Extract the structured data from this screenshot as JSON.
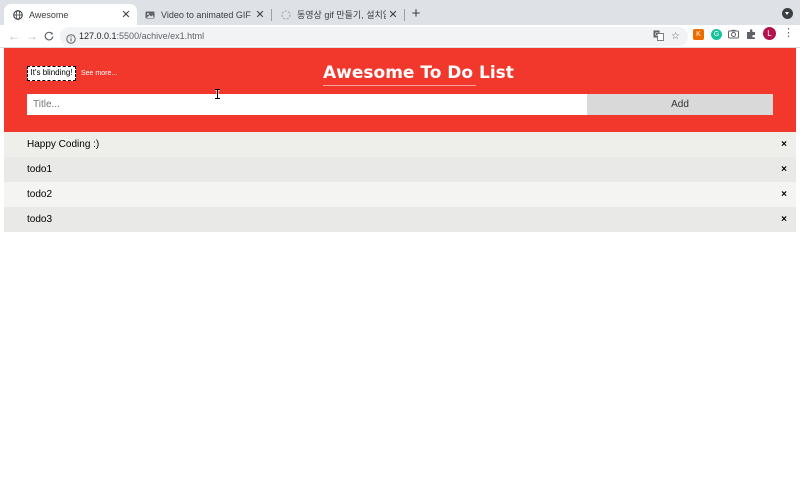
{
  "browser": {
    "tabs": [
      {
        "title": "Awesome",
        "icon": "globe-icon",
        "active": true
      },
      {
        "title": "Video to animated GIF converte",
        "icon": "image-icon",
        "active": false
      },
      {
        "title": "동영상 gif 만들기, 설치없이 동빨 만",
        "icon": "loading-icon",
        "active": false
      }
    ],
    "url_host": "127.0.0.1",
    "url_rest": ":5500/achive/ex1.html",
    "avatar_letter": "L",
    "extensions": [
      "translate-icon",
      "bookmark-star-icon",
      "colorzilla-icon",
      "grammarly-icon",
      "camera-icon",
      "puzzle-icon"
    ]
  },
  "app": {
    "blind_button": "It's blinding!",
    "see_more": "See more...",
    "title": "Awesome To Do List",
    "input_placeholder": "Title...",
    "add_label": "Add",
    "delete_symbol": "×",
    "todos": [
      "Happy Coding :)",
      "todo1",
      "todo2",
      "todo3"
    ]
  },
  "colors": {
    "header": "#f2382c",
    "button_gray": "#d9d9d9",
    "row_dark": "#eeeeeb",
    "row_light": "#f6f6f4"
  }
}
